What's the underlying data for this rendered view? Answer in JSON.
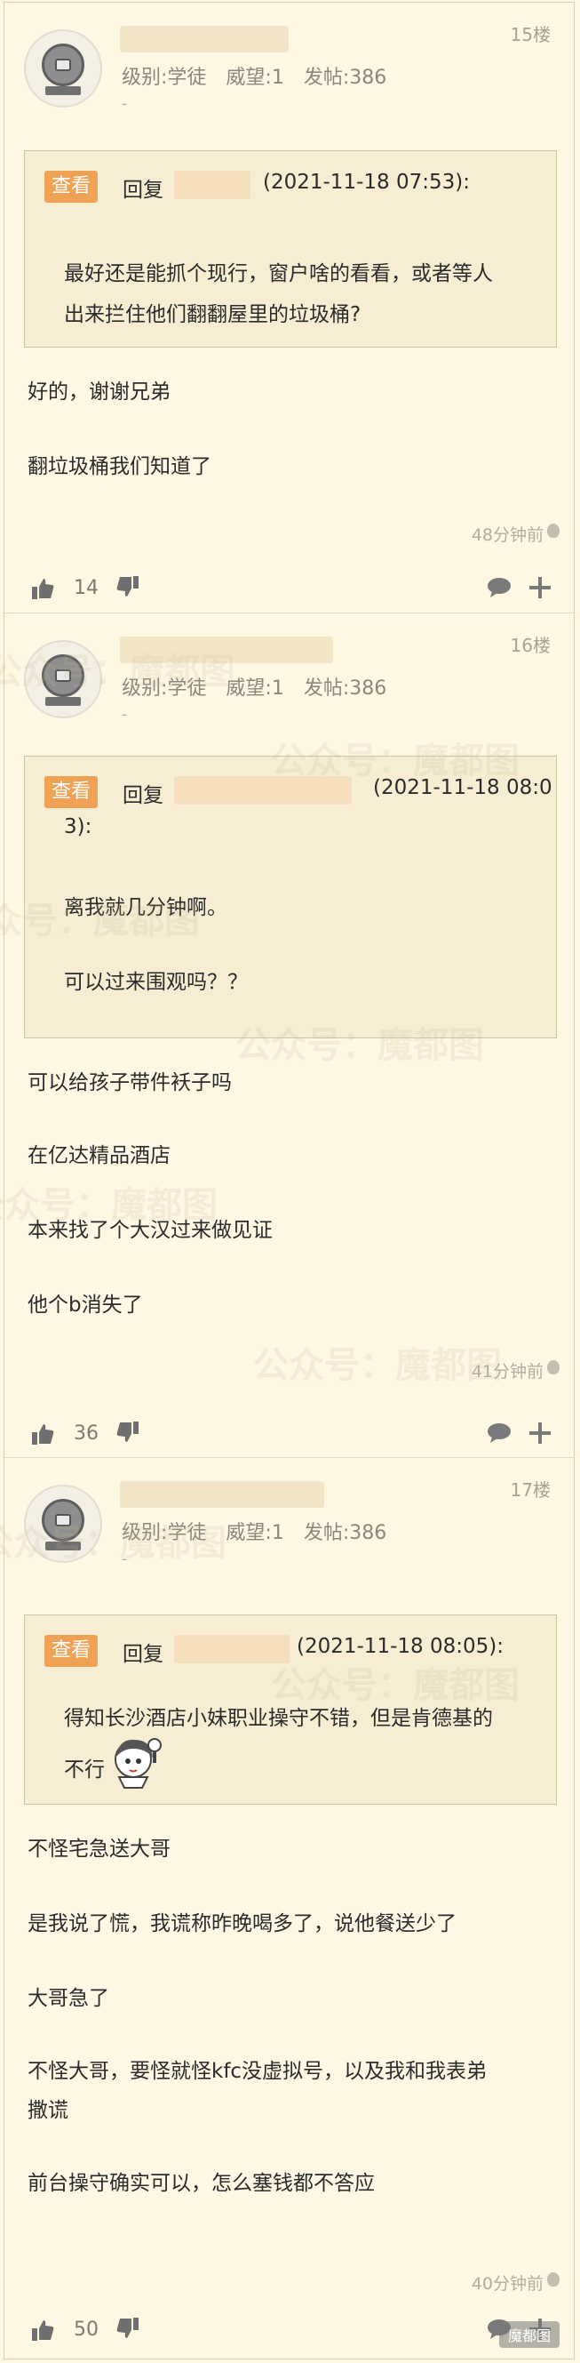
{
  "posts": [
    {
      "floor": "15楼",
      "meta": {
        "level": "级别:学徒",
        "prestige": "威望:1",
        "posts": "发帖:386"
      },
      "dash": "-",
      "quote": {
        "badge": "查看",
        "reply": "回复",
        "time": "(2021-11-18 07:53):",
        "lines": [
          "最好还是能抓个现行，窗户啥的看看，或者等人",
          "出来拦住他们翻翻屋里的垃圾桶?"
        ]
      },
      "body": [
        "好的，谢谢兄弟",
        "翻垃圾桶我们知道了"
      ],
      "time": "48分钟前",
      "likes": "14"
    },
    {
      "floor": "16楼",
      "meta": {
        "level": "级别:学徒",
        "prestige": "威望:1",
        "posts": "发帖:386"
      },
      "dash": "-",
      "quote": {
        "badge": "查看",
        "reply": "回复",
        "time": "(2021-11-18 08:0",
        "time2": "3):",
        "lines": [
          "离我就几分钟啊。",
          "可以过来围观吗？？"
        ]
      },
      "body": [
        "可以给孩子带件袄子吗",
        "在亿达精品酒店",
        "本来找了个大汉过来做见证",
        "他个b消失了"
      ],
      "time": "41分钟前",
      "likes": "36"
    },
    {
      "floor": "17楼",
      "meta": {
        "level": "级别:学徒",
        "prestige": "威望:1",
        "posts": "发帖:386"
      },
      "dash": "-",
      "quote": {
        "badge": "查看",
        "reply": "回复",
        "time": "(2021-11-18 08:05):",
        "lines": [
          "得知长沙酒店小妹职业操守不错，但是肯德基的",
          "不行"
        ]
      },
      "body": [
        "不怪宅急送大哥",
        "是我说了慌，我谎称昨晚喝多了，说他餐送少了",
        "大哥急了",
        "不怪大哥，要怪就怪kfc没虚拟号，以及我和我表弟",
        "撒谎",
        "前台操守确实可以，怎么塞钱都不答应"
      ],
      "time": "40分钟前",
      "likes": "50"
    }
  ],
  "watermark": "公众号：魔都图",
  "corner_watermark": "魔都图",
  "colors": {
    "badge": "#f0a254",
    "background": "#fdf7e4",
    "quote_bg": "#f6edd3"
  }
}
